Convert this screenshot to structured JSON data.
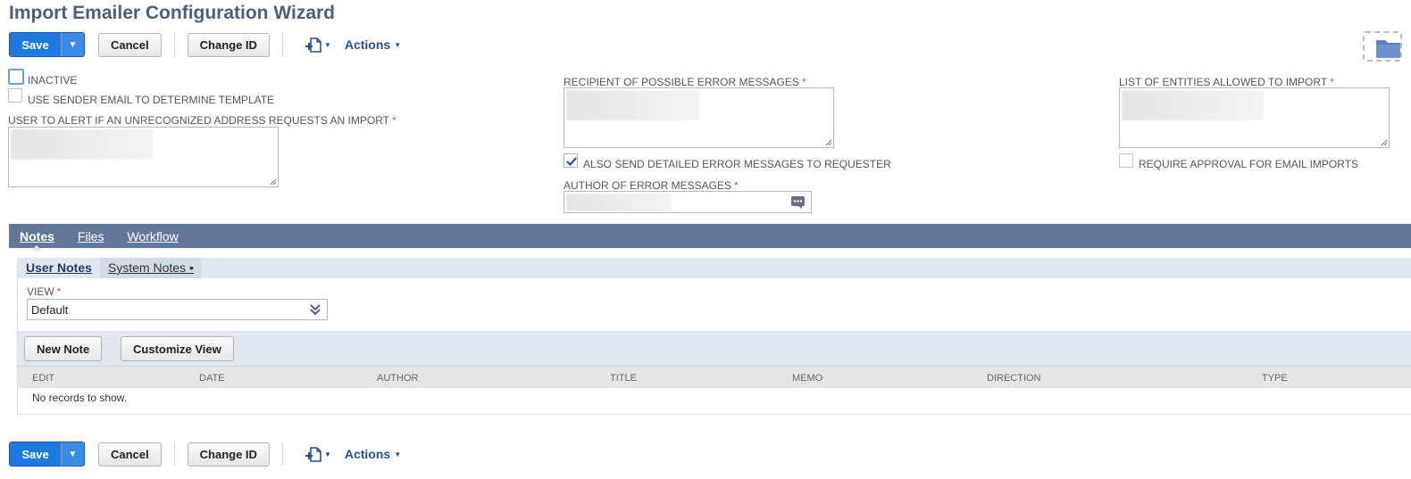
{
  "page": {
    "title": "Import Emailer Configuration Wizard"
  },
  "toolbar": {
    "save_label": "Save",
    "save_dropdown_glyph": "▼",
    "cancel_label": "Cancel",
    "change_id_label": "Change ID",
    "actions_label": "Actions",
    "caret_glyph": "▼"
  },
  "form": {
    "inactive_label": "INACTIVE",
    "use_sender_label": "USE SENDER EMAIL TO DETERMINE TEMPLATE",
    "user_alert_label": "USER TO ALERT IF AN UNRECOGNIZED ADDRESS REQUESTS AN IMPORT",
    "recipient_label": "RECIPIENT OF POSSIBLE ERROR MESSAGES",
    "also_send_label": "ALSO SEND DETAILED ERROR MESSAGES TO REQUESTER",
    "author_label": "AUTHOR OF ERROR MESSAGES",
    "entities_label": "LIST OF ENTITIES ALLOWED TO IMPORT",
    "require_approval_label": "REQUIRE APPROVAL FOR EMAIL IMPORTS",
    "required_mark": "*",
    "inactive_checked": false,
    "use_sender_checked": false,
    "also_send_checked": true,
    "require_approval_checked": false
  },
  "tabs": [
    {
      "label": "Notes",
      "active": true
    },
    {
      "label": "Files",
      "active": false
    },
    {
      "label": "Workflow",
      "active": false
    }
  ],
  "subtabs": [
    {
      "label": "User Notes",
      "active": true
    },
    {
      "label": "System Notes •",
      "active": false
    }
  ],
  "notes": {
    "view_label": "VIEW",
    "view_value": "Default",
    "new_note_label": "New Note",
    "customize_view_label": "Customize View",
    "columns": [
      "EDIT",
      "DATE",
      "AUTHOR",
      "TITLE",
      "MEMO",
      "DIRECTION",
      "TYPE"
    ],
    "empty_message": "No records to show."
  },
  "icons": {
    "new_record": "new-record-icon",
    "folder": "folder-icon",
    "picker": "list-picker-icon",
    "check": "checkmark-icon",
    "select_arrows": "double-chevron-down-icon"
  },
  "colors": {
    "title": "#4d5f79",
    "primary_button": "#1f7ae0",
    "tab_bar": "#607799",
    "subtab_bar": "#e2e7ef",
    "required": "#e05a3a",
    "link": "#2a4f8a"
  }
}
